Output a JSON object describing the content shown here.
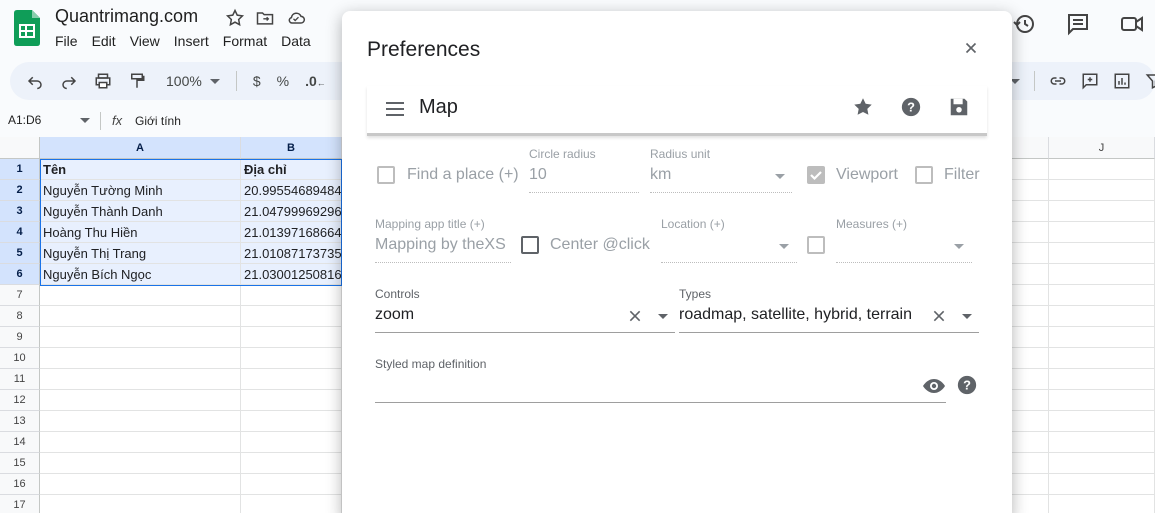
{
  "header": {
    "doc_title": "Quantrimang.com",
    "menu": [
      "File",
      "Edit",
      "View",
      "Insert",
      "Format",
      "Data"
    ],
    "icons": [
      "star-icon",
      "move-folder-icon",
      "cloud-saved-icon"
    ],
    "right_icons": [
      "history-icon",
      "comment-icon",
      "video-call-icon"
    ]
  },
  "toolbar": {
    "zoom": "100%",
    "currency": "$",
    "percent": "%",
    "decrease_decimal": ".0",
    "increase_decimal": ".0"
  },
  "formula_bar": {
    "name_box": "A1:D6",
    "fx": "fx",
    "value": "Giới tính"
  },
  "sheet": {
    "columns": [
      "A",
      "B"
    ],
    "far_column": "J",
    "rows": [
      "1",
      "2",
      "3",
      "4",
      "5",
      "6",
      "7",
      "8",
      "9",
      "10",
      "11",
      "12",
      "13",
      "14",
      "15",
      "16",
      "17"
    ],
    "cells": [
      [
        "Tên",
        "Địa chỉ"
      ],
      [
        "Nguyễn Tường Minh",
        "20.99554689484"
      ],
      [
        "Nguyễn Thành Danh",
        "21.04799969296"
      ],
      [
        "Hoàng Thu Hiền",
        "21.01397168664"
      ],
      [
        "Nguyễn Thị Trang",
        "21.01087173735"
      ],
      [
        "Nguyễn Bích Ngọc",
        "21.03001250816"
      ]
    ]
  },
  "dialog": {
    "title": "Preferences",
    "sub_title": "Map",
    "find_place": "Find a place (+)",
    "circle_radius_label": "Circle radius",
    "circle_radius_value": "10",
    "radius_unit_label": "Radius unit",
    "radius_unit_value": "km",
    "viewport": "Viewport",
    "filter": "Filter",
    "mapping_title_label": "Mapping app title (+)",
    "mapping_title_value": "Mapping by theXS",
    "center_click": "Center @click",
    "location_label": "Location (+)",
    "measures_label": "Measures (+)",
    "controls_label": "Controls",
    "controls_value": "zoom",
    "types_label": "Types",
    "types_value": "roadmap, satellite, hybrid, terrain",
    "styled_label": "Styled map definition"
  }
}
